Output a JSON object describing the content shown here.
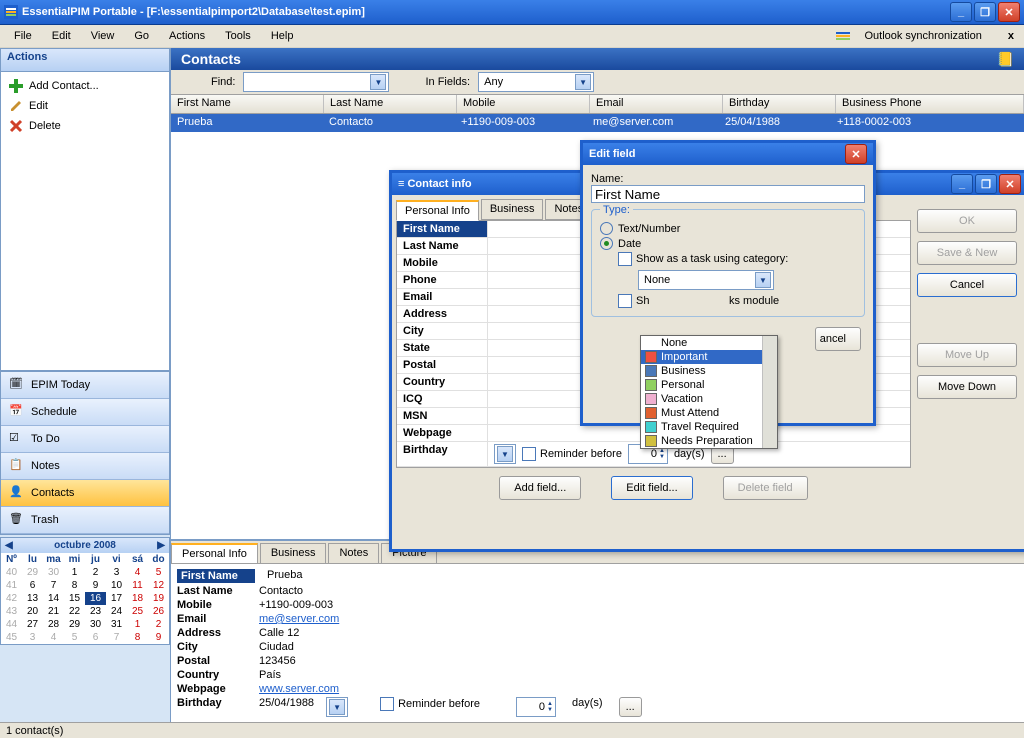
{
  "title": "EssentialPIM Portable - [F:\\essentialpimport2\\Database\\test.epim]",
  "menubar": [
    "File",
    "Edit",
    "View",
    "Go",
    "Actions",
    "Tools",
    "Help"
  ],
  "outlook_sync": "Outlook synchronization",
  "sidebar": {
    "actions_title": "Actions",
    "actions": [
      {
        "label": "Add Contact..."
      },
      {
        "label": "Edit"
      },
      {
        "label": "Delete"
      }
    ],
    "nav": [
      {
        "label": "EPIM Today"
      },
      {
        "label": "Schedule"
      },
      {
        "label": "To Do"
      },
      {
        "label": "Notes"
      },
      {
        "label": "Contacts",
        "selected": true
      },
      {
        "label": "Trash"
      }
    ],
    "calendar": {
      "title": "octubre  2008",
      "dows": [
        "Nº",
        "lu",
        "ma",
        "mi",
        "ju",
        "vi",
        "sá",
        "do"
      ],
      "rows": [
        [
          "40",
          "29",
          "30",
          "1",
          "2",
          "3",
          "4",
          "5"
        ],
        [
          "41",
          "6",
          "7",
          "8",
          "9",
          "10",
          "11",
          "12"
        ],
        [
          "42",
          "13",
          "14",
          "15",
          "16",
          "17",
          "18",
          "19"
        ],
        [
          "43",
          "20",
          "21",
          "22",
          "23",
          "24",
          "25",
          "26"
        ],
        [
          "44",
          "27",
          "28",
          "29",
          "30",
          "31",
          "1",
          "2"
        ],
        [
          "45",
          "3",
          "4",
          "5",
          "6",
          "7",
          "8",
          "9"
        ]
      ]
    }
  },
  "main": {
    "header": "Contacts",
    "find_lbl": "Find:",
    "infields_lbl": "In Fields:",
    "infields_val": "Any",
    "columns": [
      "First Name",
      "Last Name",
      "Mobile",
      "Email",
      "Birthday",
      "Business Phone"
    ],
    "row": [
      "Prueba",
      "Contacto",
      "+1190-009-003",
      "me@server.com",
      "25/04/1988",
      "+118-0002-003"
    ],
    "detail_tabs": [
      "Personal Info",
      "Business",
      "Notes",
      "Picture"
    ],
    "detail": [
      {
        "l": "First Name",
        "v": "Prueba",
        "hl": true
      },
      {
        "l": "Last Name",
        "v": "Contacto"
      },
      {
        "l": "Mobile",
        "v": "+1190-009-003"
      },
      {
        "l": "Email",
        "v": "me@server.com",
        "link": true
      },
      {
        "l": "Address",
        "v": "Calle 12"
      },
      {
        "l": "City",
        "v": "Ciudad"
      },
      {
        "l": "Postal",
        "v": "123456"
      },
      {
        "l": "Country",
        "v": "País"
      },
      {
        "l": "Webpage",
        "v": "www.server.com",
        "link": true
      },
      {
        "l": "Birthday",
        "v": "25/04/1988"
      }
    ],
    "reminder_lbl": "Reminder before",
    "reminder_val": "0",
    "reminder_unit": "day(s)",
    "more": "..."
  },
  "status": "1 contact(s)",
  "contact_info": {
    "title": "Contact info",
    "tabs": [
      "Personal Info",
      "Business",
      "Notes"
    ],
    "fields": [
      "First Name",
      "Last Name",
      "Mobile",
      "Phone",
      "Email",
      "Address",
      "City",
      "State",
      "Postal",
      "Country",
      "ICQ",
      "MSN",
      "Webpage",
      "Birthday"
    ],
    "reminder_lbl": "Reminder before",
    "reminder_val": "0",
    "reminder_unit": "day(s)",
    "more": "...",
    "btns": {
      "add": "Add field...",
      "edit": "Edit field...",
      "del": "Delete field"
    },
    "side": {
      "ok": "OK",
      "save": "Save & New",
      "cancel": "Cancel",
      "moveup": "Move Up",
      "movedown": "Move Down"
    }
  },
  "edit_field": {
    "title": "Edit field",
    "name_lbl": "Name:",
    "name_val": "First Name",
    "type_lbl": "Type:",
    "opt_text": "Text/Number",
    "opt_date": "Date",
    "chk_showtask": "Show as a task using category:",
    "cat_val": "None",
    "chk_show_tasks_module": "ks module",
    "sh_prefix": "Sh",
    "cancel": "ancel"
  },
  "dropdown": {
    "items": [
      {
        "label": "None",
        "color": ""
      },
      {
        "label": "Important",
        "color": "#f05040",
        "hl": true
      },
      {
        "label": "Business",
        "color": "#4a78b8"
      },
      {
        "label": "Personal",
        "color": "#90d060"
      },
      {
        "label": "Vacation",
        "color": "#f0b0d0"
      },
      {
        "label": "Must Attend",
        "color": "#e06030"
      },
      {
        "label": "Travel Required",
        "color": "#40d0d0"
      },
      {
        "label": "Needs Preparation",
        "color": "#d0c040"
      }
    ]
  }
}
